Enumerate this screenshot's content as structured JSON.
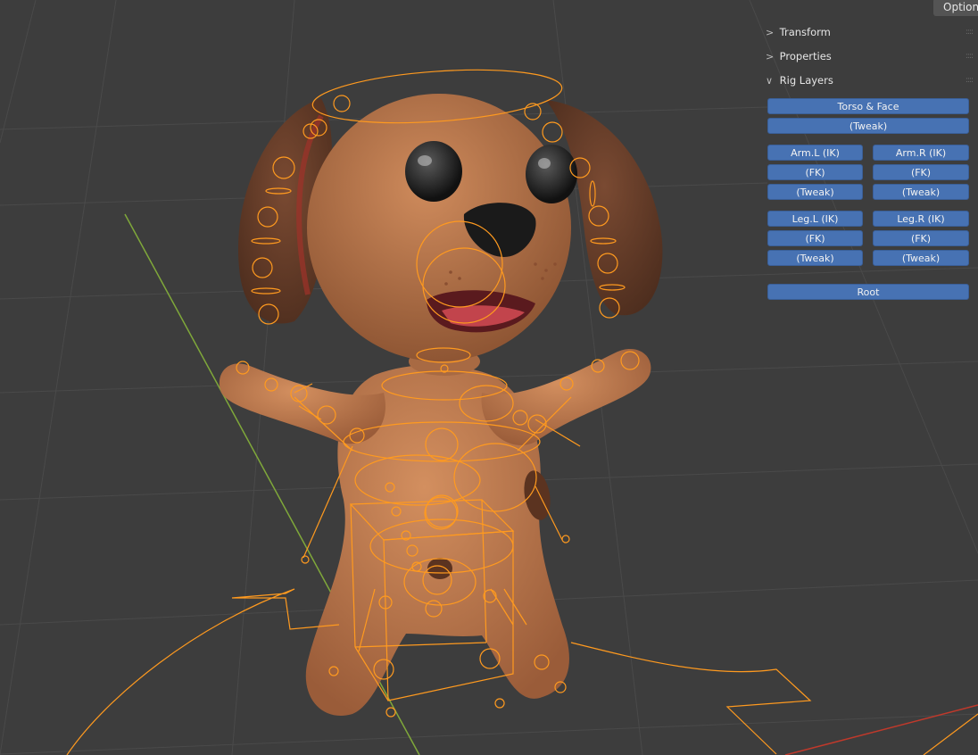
{
  "header": {
    "options_label": "Options"
  },
  "sidebar": {
    "panels": {
      "transform": "Transform",
      "properties": "Properties",
      "rig_layers": "Rig Layers"
    },
    "rig_layers": {
      "torso_face": "Torso & Face",
      "torso_tweak": "(Tweak)",
      "arm_l_ik": "Arm.L (IK)",
      "arm_r_ik": "Arm.R (IK)",
      "arm_l_fk": "(FK)",
      "arm_r_fk": "(FK)",
      "arm_l_tweak": "(Tweak)",
      "arm_r_tweak": "(Tweak)",
      "leg_l_ik": "Leg.L (IK)",
      "leg_r_ik": "Leg.R (IK)",
      "leg_l_fk": "(FK)",
      "leg_r_fk": "(FK)",
      "leg_l_tweak": "(Tweak)",
      "leg_r_tweak": "(Tweak)",
      "root": "Root"
    }
  },
  "viewport": {
    "subject": "dog-character-with-armature",
    "colors": {
      "background": "#3d3d3d",
      "grid": "#4a4a4a",
      "body": "#b9784e",
      "bone_wire": "#ff9a1f",
      "y_axis": "#7fa83a",
      "x_axis": "#c0392b"
    }
  }
}
